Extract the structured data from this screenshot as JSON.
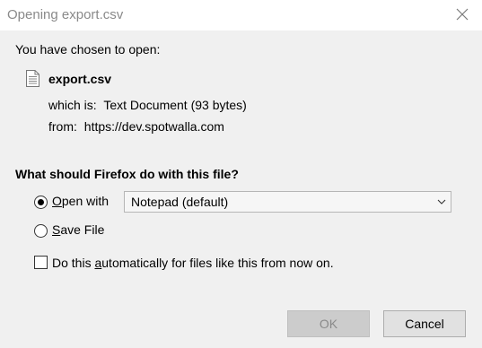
{
  "window": {
    "title": "Opening export.csv"
  },
  "file": {
    "heading": "You have chosen to open:",
    "name": "export.csv",
    "which_label": "which is:",
    "type": "Text Document (93 bytes)",
    "from_label": "from:",
    "source": "https://dev.spotwalla.com"
  },
  "question": "What should Firefox do with this file?",
  "options": {
    "open_with_access_key": "O",
    "open_with_rest": "pen with",
    "open_with_selected": true,
    "application": "Notepad (default)",
    "save_file_access_key": "S",
    "save_file_rest": "ave File",
    "save_file_selected": false,
    "auto_pre": "Do this ",
    "auto_access_key": "a",
    "auto_rest": "utomatically for files like this from now on.",
    "auto_checked": false
  },
  "buttons": {
    "ok": "OK",
    "cancel": "Cancel",
    "ok_enabled": false
  }
}
